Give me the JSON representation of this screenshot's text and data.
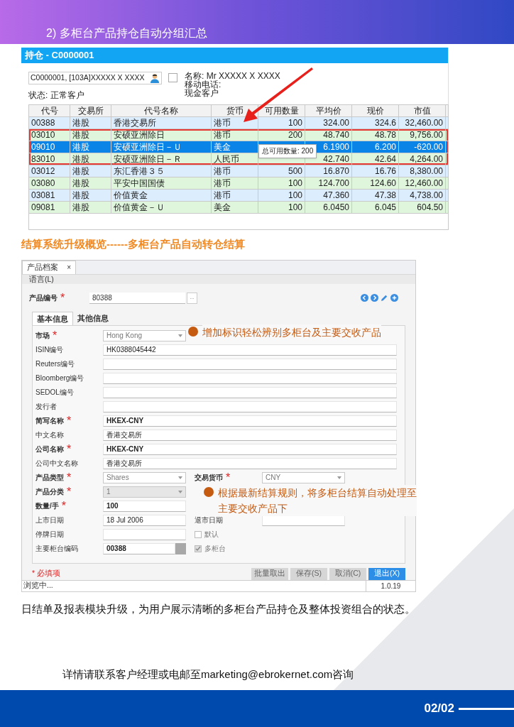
{
  "header": {
    "title": "2) 多柜台产品持仓自动分组汇总"
  },
  "positions_window": {
    "title": "持仓 - C0000001",
    "client_field": {
      "value": "C0000001, [103A]XXXXX X XXXX"
    },
    "checkbox": {
      "checked": false
    },
    "name": "名称: Mr XXXXX X XXXX",
    "mobile": "移动电话:",
    "status": "状态: 正常客户",
    "account_type": "现金客户",
    "columns": [
      "代号",
      "交易所",
      "代号名称",
      "货币",
      "可用数量",
      "平均价",
      "现价",
      "市值"
    ],
    "rows": [
      {
        "cells": [
          "00388",
          "港股",
          "香港交易所",
          "港币",
          "100",
          "324.00",
          "324.6",
          "32,460.00"
        ],
        "selected": false,
        "grouped": false,
        "color": "#dcedfd"
      },
      {
        "cells": [
          "03010",
          "港股",
          "安硕亚洲除日",
          "港币",
          "200",
          "48.740",
          "48.78",
          "9,756.00"
        ],
        "selected": false,
        "grouped": true,
        "color": "#dff6dc"
      },
      {
        "cells": [
          "09010",
          "港股",
          "安硕亚洲除日－Ｕ",
          "美金",
          null,
          "6.1900",
          "6.200",
          "-620.00"
        ],
        "selected": true,
        "grouped": true
      },
      {
        "cells": [
          "83010",
          "港股",
          "安硕亚洲除日－Ｒ",
          "人民币",
          null,
          "42.740",
          "42.64",
          "4,264.00"
        ],
        "selected": false,
        "grouped": true,
        "color": "#dff6dc"
      },
      {
        "cells": [
          "03012",
          "港股",
          "东汇香港３５",
          "港币",
          "500",
          "16.870",
          "16.76",
          "8,380.00"
        ],
        "selected": false,
        "grouped": false,
        "color": "#dcedfd"
      },
      {
        "cells": [
          "03080",
          "港股",
          "平安中国国债",
          "港币",
          "100",
          "124.700",
          "124.60",
          "12,460.00"
        ],
        "selected": false,
        "grouped": false,
        "color": "#dff6dc"
      },
      {
        "cells": [
          "03081",
          "港股",
          "价值黄金",
          "港币",
          "100",
          "47.360",
          "47.38",
          "4,738.00"
        ],
        "selected": false,
        "grouped": false,
        "color": "#dcedfd"
      },
      {
        "cells": [
          "09081",
          "港股",
          "价值黄金－Ｕ",
          "美金",
          "100",
          "6.0450",
          "6.045",
          "604.50"
        ],
        "selected": false,
        "grouped": false,
        "color": "#dff6dc"
      }
    ],
    "tooltip": "总可用数量: 200"
  },
  "section_heading": "结算系统升级概览------多柜台产品自动转仓结算",
  "product_window": {
    "tab": {
      "label": "产品档案",
      "close": "×"
    },
    "menu": "语言(L)",
    "product_id": {
      "label": "产品编号",
      "mark": "*",
      "value": "80388",
      "button": "..."
    },
    "tabs": [
      {
        "label": "基本信息",
        "selected": true
      },
      {
        "label": "其他信息",
        "selected": false
      }
    ],
    "rows": [
      {
        "full_width": false,
        "fields": [
          {
            "kind": "select",
            "label": "市场",
            "mark": "*",
            "value": "Hong Kong",
            "disabled": false
          }
        ]
      },
      {
        "full_width": true,
        "fields": [
          {
            "kind": "text",
            "label": "ISIN编号",
            "value": "HK0388045442",
            "strong": false
          }
        ]
      },
      {
        "full_width": true,
        "fields": [
          {
            "kind": "text",
            "label": "Reuters编号"
          }
        ]
      },
      {
        "full_width": true,
        "fields": [
          {
            "kind": "text",
            "label": "Bloomberg编号"
          }
        ]
      },
      {
        "full_width": true,
        "fields": [
          {
            "kind": "text",
            "label": "SEDOL编号"
          }
        ]
      },
      {
        "full_width": true,
        "fields": [
          {
            "kind": "text",
            "label": "发行者"
          }
        ]
      },
      {
        "full_width": true,
        "fields": [
          {
            "kind": "text",
            "label": "简写名称",
            "mark": "*",
            "value": "HKEX-CNY",
            "strong": true
          }
        ]
      },
      {
        "full_width": true,
        "fields": [
          {
            "kind": "text",
            "label": "中文名称",
            "value": "香港交易所",
            "strong": false
          }
        ]
      },
      {
        "full_width": true,
        "fields": [
          {
            "kind": "text",
            "label": "公司名称",
            "mark": "*",
            "value": "HKEX-CNY",
            "strong": true
          }
        ]
      },
      {
        "full_width": true,
        "fields": [
          {
            "kind": "text",
            "label": "公司中文名称",
            "value": "香港交易所",
            "strong": false
          }
        ]
      },
      {
        "full_width": false,
        "fields": [
          {
            "kind": "select",
            "label": "产品类型",
            "mark": "*",
            "value": "Shares",
            "disabled": false
          },
          {
            "kind": "select",
            "label": "交易货币",
            "mark": "*",
            "value": "CNY",
            "disabled": false
          }
        ]
      },
      {
        "full_width": false,
        "fields": [
          {
            "kind": "select",
            "label": "产品分类",
            "mark": "*",
            "value": "1",
            "disabled": true
          }
        ]
      },
      {
        "full_width": false,
        "fields": [
          {
            "kind": "text",
            "label": "数量/手",
            "mark": "*",
            "value": "100",
            "strong": true
          }
        ]
      },
      {
        "full_width": false,
        "fields": [
          {
            "kind": "text",
            "label": "上市日期",
            "value": "18 Jul 2006",
            "strong": false
          },
          {
            "kind": "text",
            "label": "退市日期"
          }
        ]
      },
      {
        "full_width": false,
        "fields": [
          {
            "kind": "text",
            "label": "停牌日期"
          },
          {
            "kind": "checkbox",
            "label": "默认",
            "checked": false,
            "disabled": false
          }
        ]
      },
      {
        "full_width": false,
        "fields": [
          {
            "kind": "lookup",
            "label": "主要柜台编码",
            "value": "00388",
            "strong": true
          },
          {
            "kind": "checkbox",
            "label": "多柜台",
            "checked": true,
            "disabled": true
          }
        ]
      }
    ],
    "required_note": "* 必填项",
    "buttons": [
      {
        "label": "批量取出",
        "disabled": true,
        "primary": false
      },
      {
        "label": "保存(S)",
        "disabled": true,
        "primary": false
      },
      {
        "label": "取消(C)",
        "disabled": true,
        "primary": false
      },
      {
        "label": "退出(X)",
        "disabled": false,
        "primary": true
      }
    ],
    "status_bar": {
      "text": "浏览中...",
      "version": "1.0.19"
    },
    "notes": [
      {
        "lines": [
          "增加标识轻松辨别多柜台及主要交收产品"
        ]
      },
      {
        "lines": [
          "根据最新结算规则，将多柜台结算自动处理至",
          "主要交收产品下"
        ]
      }
    ]
  },
  "paragraph": "日结单及报表模块升级，为用户展示清晰的多柜台产品持仓及整体投资组合的状态。",
  "contact": "详情请联系客户经理或电邮至marketing@ebrokernet.com咨询",
  "page_number": "02/02"
}
